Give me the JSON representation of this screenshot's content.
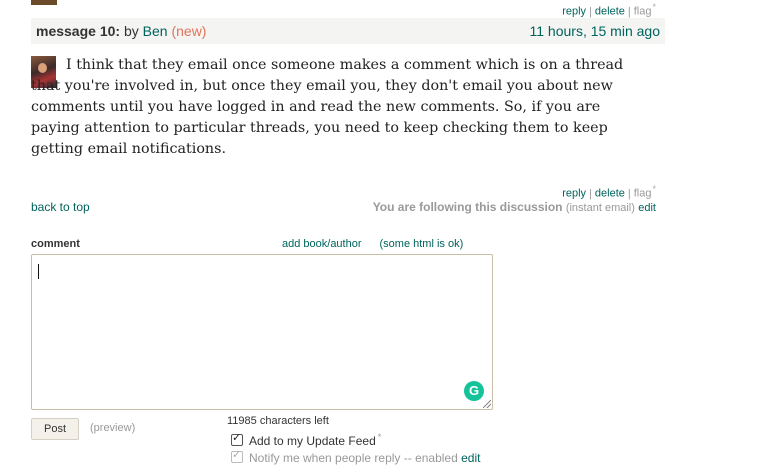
{
  "top_actions": {
    "reply": "reply",
    "delete": "delete",
    "flag": "flag",
    "flag_star": "*"
  },
  "message": {
    "number_label": "message 10:",
    "by": "by",
    "author": "Ben",
    "new_tag": "(new)",
    "time": "11 hours, 15 min ago",
    "body": "I think that they email once someone makes a comment which is on a thread that you're involved in, but once they email you, they don't email you about new comments until you have logged in and read the new comments. So, if you are paying attention to particular threads, you need to keep checking them to keep getting email notifications."
  },
  "message_actions": {
    "reply": "reply",
    "delete": "delete",
    "flag": "flag",
    "flag_star": "*"
  },
  "back_to_top": "back to top",
  "following": {
    "text": "You are following this discussion",
    "mode": "(instant email)",
    "edit": "edit"
  },
  "comment_form": {
    "label": "comment",
    "add_book_author": "add book/author",
    "html_ok": "(some html is ok)",
    "value": "",
    "grammarly_icon": "G",
    "post": "Post",
    "preview": "(preview)",
    "chars_left": "11985 characters left",
    "update_feed_label": "Add to my Update Feed",
    "update_feed_star": "*",
    "update_feed_checked": true,
    "notify_label": "Notify me when people reply -- enabled",
    "notify_edit": "edit",
    "notify_checked": true
  },
  "colors": {
    "link": "#00635d",
    "new_tag": "#e0735a",
    "header_bg": "#f4f4f2",
    "grammarly": "#15c39a"
  }
}
